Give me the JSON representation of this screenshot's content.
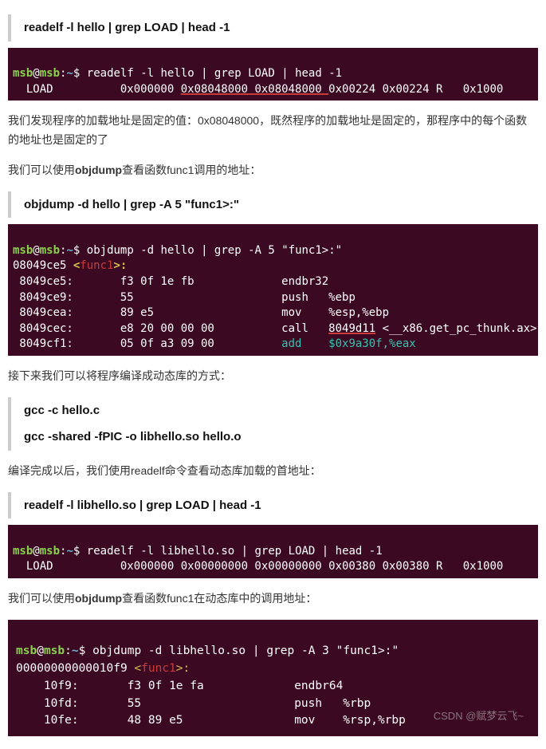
{
  "block1": {
    "cmd_quote": "readelf -l hello | grep LOAD | head -1",
    "prompt": {
      "user": "msb",
      "at": "@",
      "host": "msb",
      "colon": ":",
      "path": "~",
      "dollar": "$"
    },
    "cmd": "readelf -l hello | grep LOAD | head -1",
    "out": {
      "label": "  LOAD          ",
      "c1": "0x000000 ",
      "c2": "0x08048000 ",
      "c3": "0x08048000 ",
      "c4": "0x00224 0x00224 R   0x1000"
    }
  },
  "para1": "我们发现程序的加载地址是固定的值：0x08048000，既然程序的加载地址是固定的，那程序中的每个函数的地址也是固定的了",
  "para2_a": "我们可以使用",
  "para2_b": "objdump",
  "para2_c": "查看函数func1调用的地址：",
  "block2": {
    "cmd_quote": "objdump -d hello | grep -A 5 \"func1>:\"",
    "cmd": "objdump -d hello | grep -A 5 \"func1>:\"",
    "addr_line": {
      "addr": "08049ce5 ",
      "lt": "<",
      "fn": "func1",
      "gt": ">:"
    },
    "rows": [
      {
        "a": " 8049ce5:       ",
        "b": "f3 0f 1e fb             ",
        "m": "endbr32 "
      },
      {
        "a": " 8049ce9:       ",
        "b": "55                      ",
        "m": "push   %ebp"
      },
      {
        "a": " 8049cea:       ",
        "b": "89 e5                   ",
        "m": "mov    %esp,%ebp"
      },
      {
        "a": " 8049cec:       ",
        "b": "e8 20 00 00 00          ",
        "m": "call   ",
        "tgt": "8049d11",
        " tail": " <__x86.get_pc_thunk.ax>"
      },
      {
        "a": " 8049cf1:       ",
        "b": "05 0f a3 09 00          ",
        "m": "add    $0x9a30f,%eax"
      }
    ]
  },
  "para3": "接下来我们可以将程序编译成动态库的方式：",
  "block3": {
    "l1": "gcc -c hello.c",
    "l2": "gcc -shared -fPIC -o libhello.so hello.o"
  },
  "para4": "编译完成以后，我们使用readelf命令查看动态库加载的首地址：",
  "block4": {
    "cmd_quote": "readelf -l libhello.so | grep LOAD | head -1",
    "cmd": "readelf -l libhello.so | grep LOAD | head -1",
    "out": "  LOAD          0x000000 0x00000000 0x00000000 0x00380 0x00380 R   0x1000"
  },
  "para5_a": "我们可以使用",
  "para5_b": "objdump",
  "para5_c": "查看函数func1在动态库中的调用地址：",
  "block5": {
    "cmd": "objdump -d libhello.so | grep -A 3 \"func1>:\"",
    "addr_line": {
      "addr": "00000000000010f9 ",
      "lt": "<",
      "fn": "func1",
      "gt": ">:"
    },
    "rows": [
      {
        "a": "    10f9:       ",
        "b": "f3 0f 1e fa             ",
        "m": "endbr64 "
      },
      {
        "a": "    10fd:       ",
        "b": "55                      ",
        "m": "push   %rbp"
      },
      {
        "a": "    10fe:       ",
        "b": "48 89 e5                ",
        "m": "mov    %rsp,%rbp"
      }
    ]
  },
  "watermark": "CSDN @赋梦云飞~"
}
